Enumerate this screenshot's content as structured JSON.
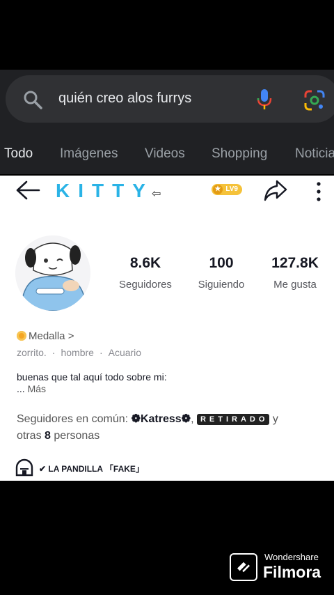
{
  "google": {
    "query": "quién creo alos furrys",
    "tabs": [
      "Todo",
      "Imágenes",
      "Videos",
      "Shopping",
      "Noticia"
    ],
    "active_tab": "Todo"
  },
  "profile": {
    "name": "KITTY",
    "name_suffix": "⇦",
    "level": "LV9",
    "stats": [
      {
        "value": "8.6K",
        "label": "Seguidores"
      },
      {
        "value": "100",
        "label": "Siguiendo"
      },
      {
        "value": "127.8K",
        "label": "Me gusta"
      }
    ],
    "medal": "Medalla >",
    "tags": [
      "zorrito.",
      "hombre",
      "Acuario"
    ],
    "bio_line1": "buenas que tal aquí todo sobre mi:",
    "bio_ellipsis": "...",
    "bio_more": "Más",
    "common_prefix": "Seguidores en común:",
    "common_user1": "❁Katress❁",
    "common_user2": "RETIRADO",
    "common_and": "y",
    "common_others_prefix": "otras",
    "common_count": "8",
    "common_others_suffix": "personas",
    "group": "✔ LA PANDILLA 「FAKE」"
  },
  "watermark": {
    "top": "Wondershare",
    "brand": "Filmora"
  },
  "colors": {
    "google_bg": "#202124",
    "search_pill": "#303134",
    "name_accent": "#2ab3e6",
    "level_badge": "#f5c23a"
  }
}
